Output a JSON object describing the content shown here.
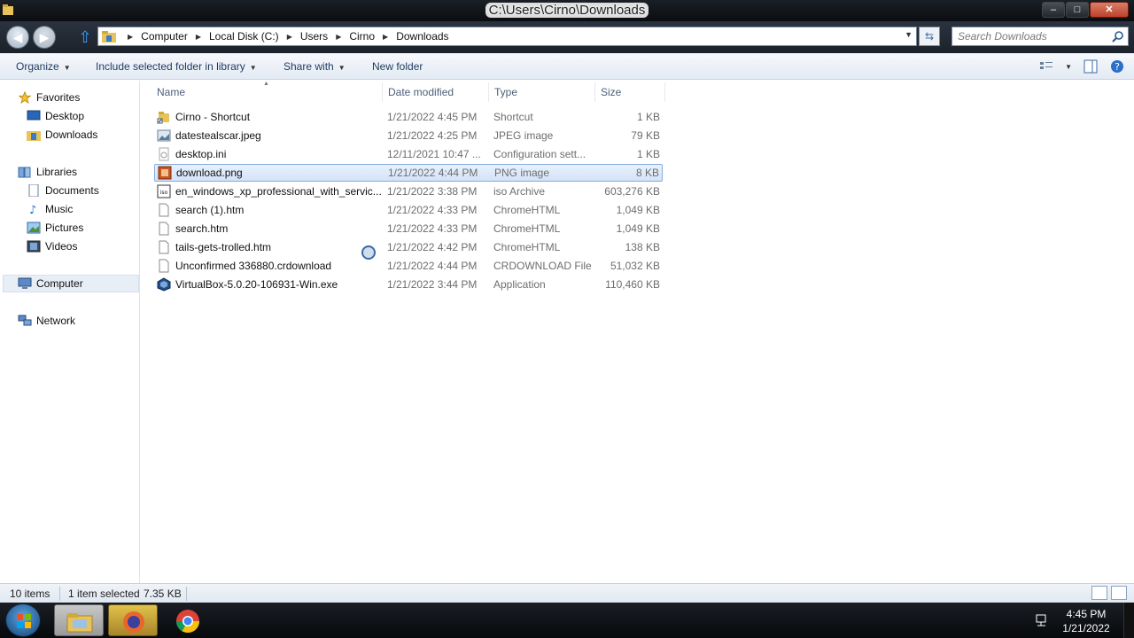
{
  "window": {
    "title": "C:\\Users\\Cirno\\Downloads",
    "minimize": "–",
    "maximize": "□",
    "close": "✕"
  },
  "nav": {
    "breadcrumb": [
      "Computer",
      "Local Disk (C:)",
      "Users",
      "Cirno",
      "Downloads"
    ],
    "search_placeholder": "Search Downloads"
  },
  "commands": {
    "organize": "Organize",
    "include_library": "Include selected folder in library",
    "share_with": "Share with",
    "new_folder": "New folder"
  },
  "sidebar": {
    "favorites": "Favorites",
    "desktop": "Desktop",
    "downloads": "Downloads",
    "libraries": "Libraries",
    "documents": "Documents",
    "music": "Music",
    "pictures": "Pictures",
    "videos": "Videos",
    "computer": "Computer",
    "network": "Network"
  },
  "columns": {
    "name": "Name",
    "date": "Date modified",
    "type": "Type",
    "size": "Size"
  },
  "files": [
    {
      "name": "Cirno - Shortcut",
      "date": "1/21/2022 4:45 PM",
      "type": "Shortcut",
      "size": "1 KB",
      "icon": "shortcut-icon"
    },
    {
      "name": "datestealscar.jpeg",
      "date": "1/21/2022 4:25 PM",
      "type": "JPEG image",
      "size": "79 KB",
      "icon": "image-icon"
    },
    {
      "name": "desktop.ini",
      "date": "12/11/2021 10:47 ...",
      "type": "Configuration sett...",
      "size": "1 KB",
      "icon": "settings-file-icon"
    },
    {
      "name": "download.png",
      "date": "1/21/2022 4:44 PM",
      "type": "PNG image",
      "size": "8 KB",
      "icon": "png-icon",
      "selected": true
    },
    {
      "name": "en_windows_xp_professional_with_servic...",
      "date": "1/21/2022 3:38 PM",
      "type": "iso Archive",
      "size": "603,276 KB",
      "icon": "iso-icon"
    },
    {
      "name": "search (1).htm",
      "date": "1/21/2022 4:33 PM",
      "type": "ChromeHTML",
      "size": "1,049 KB",
      "icon": "document-icon"
    },
    {
      "name": "search.htm",
      "date": "1/21/2022 4:33 PM",
      "type": "ChromeHTML",
      "size": "1,049 KB",
      "icon": "document-icon"
    },
    {
      "name": "tails-gets-trolled.htm",
      "date": "1/21/2022 4:42 PM",
      "type": "ChromeHTML",
      "size": "138 KB",
      "icon": "document-icon"
    },
    {
      "name": "Unconfirmed 336880.crdownload",
      "date": "1/21/2022 4:44 PM",
      "type": "CRDOWNLOAD File",
      "size": "51,032 KB",
      "icon": "document-icon"
    },
    {
      "name": "VirtualBox-5.0.20-106931-Win.exe",
      "date": "1/21/2022 3:44 PM",
      "type": "Application",
      "size": "110,460 KB",
      "icon": "virtualbox-icon"
    }
  ],
  "status": {
    "count": "10 items",
    "selected": "1 item selected",
    "size": "7.35 KB"
  },
  "taskbar": {
    "time": "4:45 PM",
    "date": "1/21/2022"
  }
}
